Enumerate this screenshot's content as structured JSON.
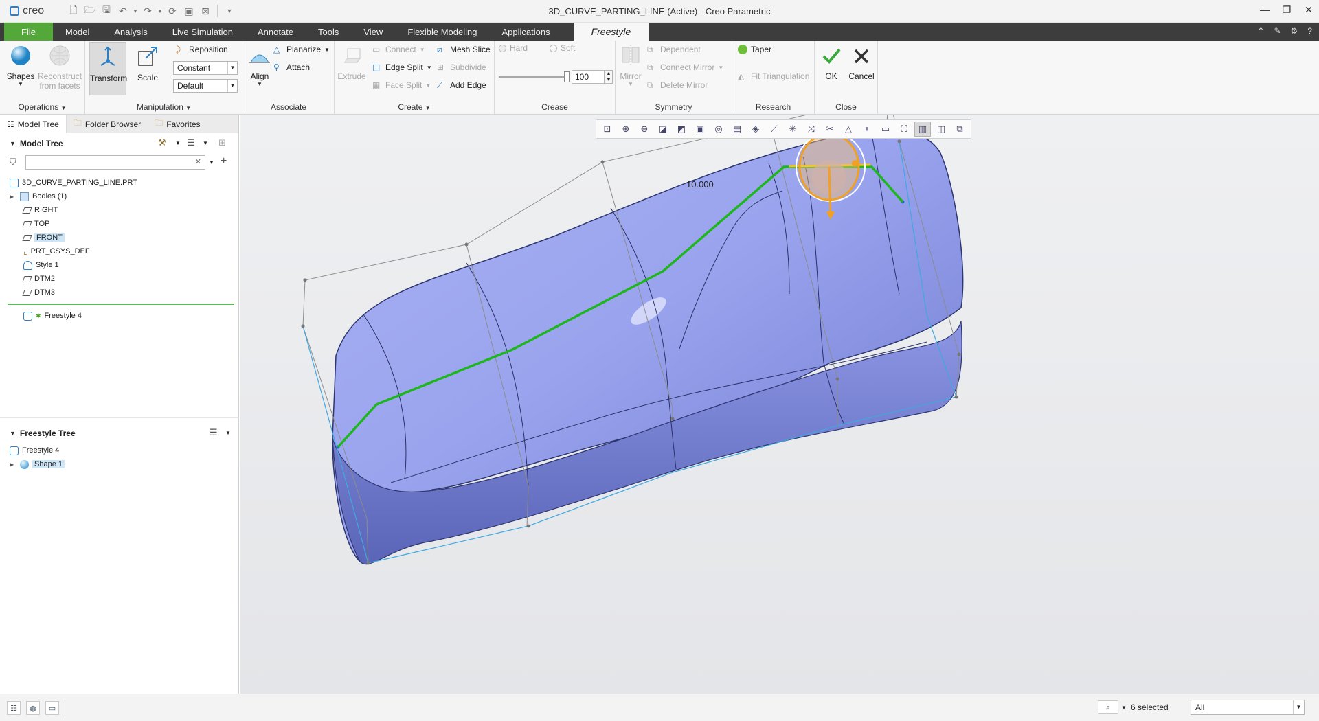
{
  "app": {
    "logo_text": "creo",
    "window_title": "3D_CURVE_PARTING_LINE (Active) - Creo Parametric"
  },
  "menu": {
    "tabs": [
      "File",
      "Model",
      "Analysis",
      "Live Simulation",
      "Annotate",
      "Tools",
      "View",
      "Flexible Modeling",
      "Applications"
    ],
    "active_tab": "Freestyle"
  },
  "ribbon": {
    "operations": {
      "label": "Operations",
      "shapes": "Shapes",
      "reconstruct": "Reconstruct from facets"
    },
    "manipulation": {
      "label": "Manipulation",
      "transform": "Transform",
      "scale": "Scale",
      "reposition": "Reposition",
      "combo1": "Constant",
      "combo2": "Default"
    },
    "associate": {
      "label": "Associate",
      "align": "Align",
      "planarize": "Planarize",
      "attach": "Attach"
    },
    "create": {
      "label": "Create",
      "extrude": "Extrude",
      "connect": "Connect",
      "edge_split": "Edge Split",
      "face_split": "Face Split",
      "mesh_slice": "Mesh Slice",
      "subdivide": "Subdivide",
      "add_edge": "Add Edge"
    },
    "crease": {
      "label": "Crease",
      "hard": "Hard",
      "soft": "Soft",
      "value": "100"
    },
    "symmetry": {
      "label": "Symmetry",
      "mirror": "Mirror",
      "dependent": "Dependent",
      "connect_mirror": "Connect Mirror",
      "delete_mirror": "Delete Mirror"
    },
    "research": {
      "label": "Research",
      "taper": "Taper",
      "fit_triangulation": "Fit Triangulation"
    },
    "close": {
      "label": "Close",
      "ok": "OK",
      "cancel": "Cancel"
    }
  },
  "left_panel": {
    "tabs": [
      "Model Tree",
      "Folder Browser",
      "Favorites"
    ],
    "model_tree_title": "Model Tree",
    "search_placeholder": "",
    "model_items": [
      "3D_CURVE_PARTING_LINE.PRT",
      "Bodies (1)",
      "RIGHT",
      "TOP",
      "FRONT",
      "PRT_CSYS_DEF",
      "Style 1",
      "DTM2",
      "DTM3"
    ],
    "insert_item": "Freestyle 4",
    "freestyle_tree_title": "Freestyle Tree",
    "freestyle_items": [
      "Freestyle 4",
      "Shape 1"
    ]
  },
  "viewport": {
    "dimension_text": "10.000"
  },
  "status": {
    "selected": "6 selected",
    "filter": "All"
  },
  "colors": {
    "file_tab": "#54a83a",
    "tab_bar": "#3d3d3d",
    "surface": "#8c98e6",
    "parting_line": "#1fb51f",
    "dragger": "#f0a023"
  }
}
